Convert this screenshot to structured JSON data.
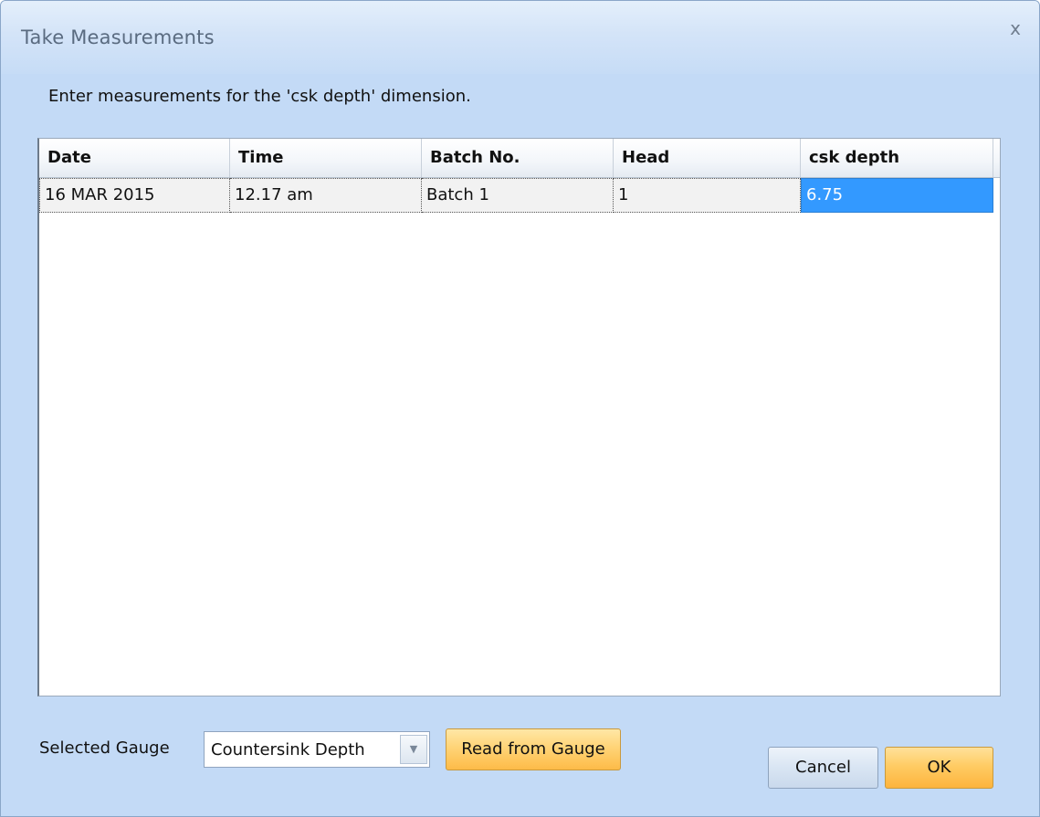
{
  "window": {
    "title": "Take Measurements",
    "close_glyph": "x"
  },
  "instruction": "Enter measurements for the 'csk depth' dimension.",
  "grid": {
    "columns": [
      "Date",
      "Time",
      "Batch No.",
      "Head",
      "csk depth"
    ],
    "rows": [
      [
        "16 MAR 2015",
        "12.17 am",
        "Batch 1",
        "1",
        "6.75"
      ]
    ],
    "selected_cell": {
      "row": 0,
      "column": 4
    }
  },
  "gauge": {
    "label": "Selected Gauge",
    "selected_value": "Countersink Depth",
    "dropdown_glyph": "▼"
  },
  "buttons": {
    "read_from_gauge": "Read from Gauge",
    "cancel": "Cancel",
    "ok": "OK"
  },
  "colors": {
    "window_bg": "#c3daf6",
    "selection": "#3399ff",
    "accent_button": "#ffcc64"
  }
}
